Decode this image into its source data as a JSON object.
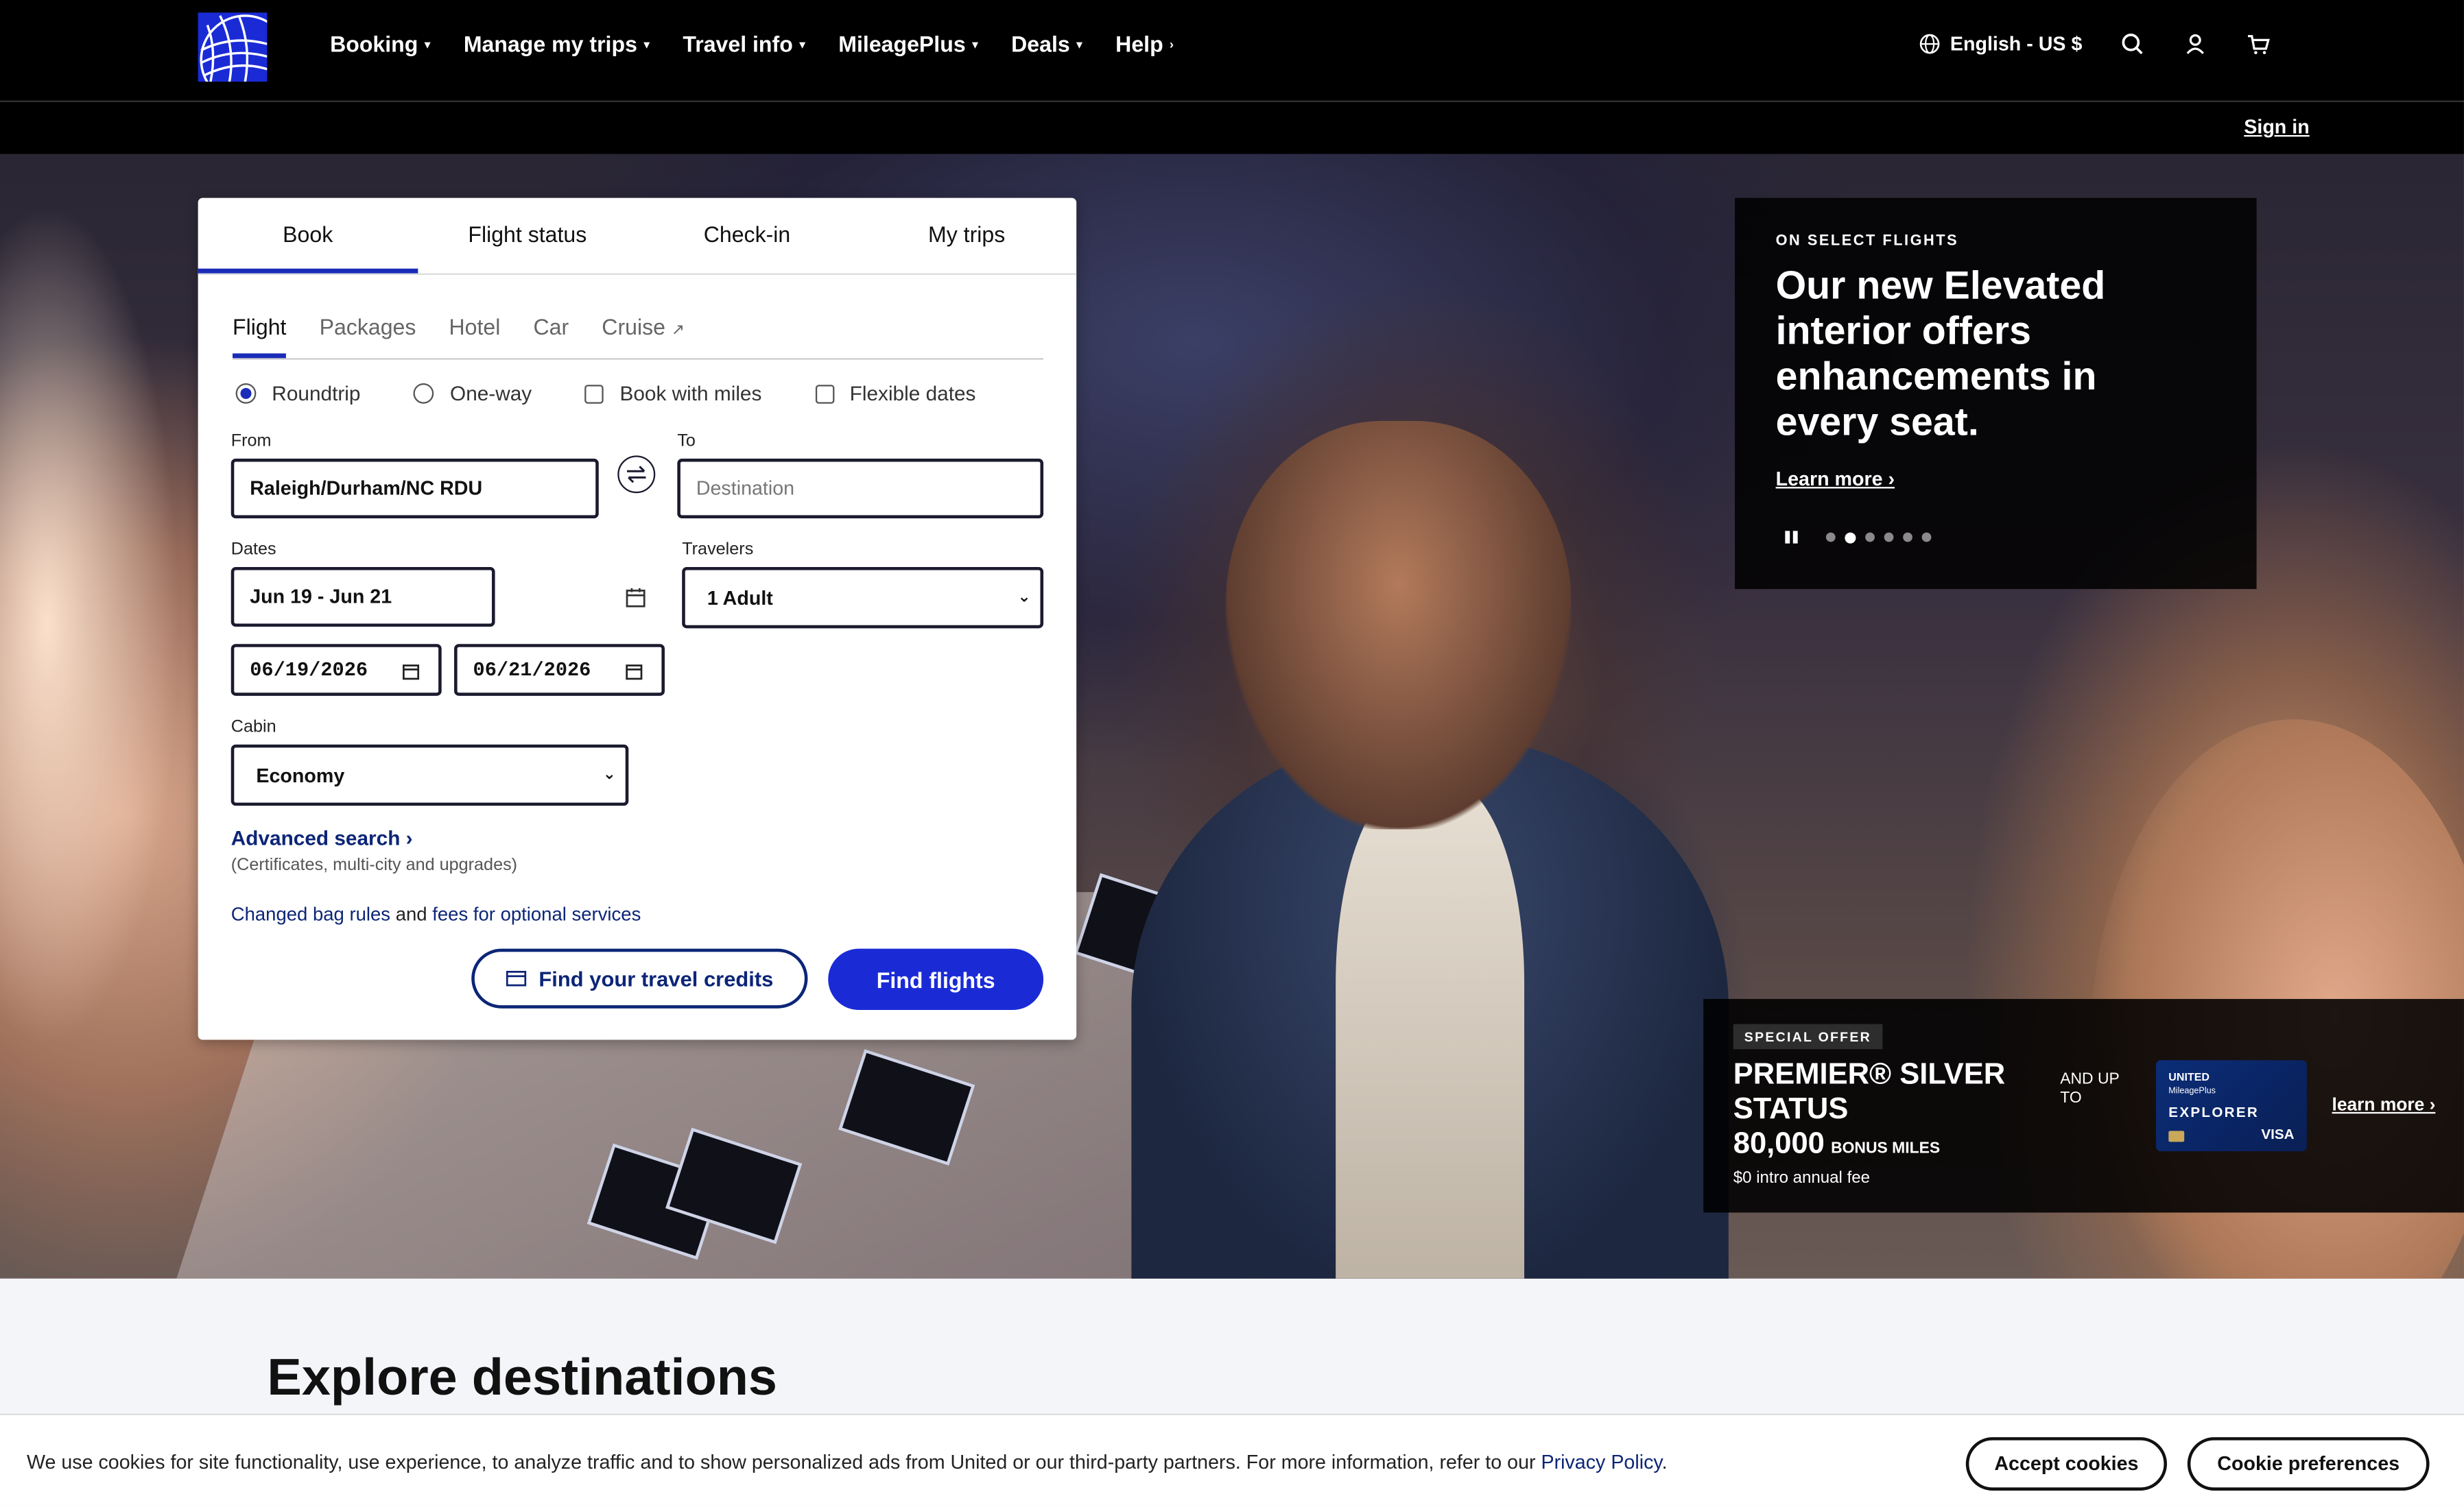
{
  "header": {
    "nav": [
      {
        "label": "Booking",
        "arrow": "▾"
      },
      {
        "label": "Manage my trips",
        "arrow": "▾"
      },
      {
        "label": "Travel info",
        "arrow": "▾"
      },
      {
        "label": "MileagePlus",
        "arrow": "▾"
      },
      {
        "label": "Deals",
        "arrow": "▾"
      },
      {
        "label": "Help",
        "arrow": "›"
      }
    ],
    "language": "English - US $",
    "icons": [
      "globe-icon",
      "search-icon",
      "user-icon",
      "cart-icon"
    ],
    "sign_in": "Sign in"
  },
  "booking": {
    "tabs": [
      "Book",
      "Flight status",
      "Check-in",
      "My trips"
    ],
    "active_tab": "Book",
    "subtabs": [
      "Flight",
      "Packages",
      "Hotel",
      "Car",
      "Cruise"
    ],
    "cruise_ext_icon": "↗",
    "active_subtab": "Flight",
    "trip_options": {
      "roundtrip": "Roundtrip",
      "oneway": "One-way",
      "miles": "Book with miles",
      "flexible": "Flexible dates"
    },
    "trip_selected": "Roundtrip",
    "from_label": "From",
    "from_value": "Raleigh/Durham/NC RDU",
    "to_label": "To",
    "to_placeholder": "Destination",
    "dates_label": "Dates",
    "dates_value": "Jun 19 - Jun 21",
    "depart_date": "06/19/2026",
    "return_date": "06/21/2026",
    "travelers_label": "Travelers",
    "travelers_value": "1 Adult",
    "cabin_label": "Cabin",
    "cabin_value": "Economy",
    "advanced": "Advanced search ›",
    "advanced_sub": "(Certificates, multi-city and upgrades)",
    "bag_link": "Changed bag rules",
    "bag_and": " and ",
    "fees_link": "fees for optional services",
    "credits_button": "Find your travel credits",
    "find_button": "Find flights"
  },
  "promo": {
    "kicker": "ON SELECT FLIGHTS",
    "title": "Our new Elevated interior offers enhancements in every seat.",
    "link": "Learn more ›",
    "slide_count": 6,
    "active_slide": 2
  },
  "offer": {
    "badge": "SPECIAL OFFER",
    "title": "PREMIER® SILVER STATUS",
    "miles": "80,000",
    "bonus": "BONUS MILES",
    "fee": "$0 intro annual fee",
    "andup": "AND UP TO",
    "card_brand": "UNITED",
    "card_program": "MileagePlus",
    "card_name": "EXPLORER",
    "card_network": "VISA",
    "link": "learn more ›"
  },
  "explore": {
    "title": "Explore destinations"
  },
  "cookie": {
    "text": "We use cookies for site functionality, use experience, to analyze traffic and to show personalized ads from United or our third-party partners. For more information, refer to our ",
    "policy": "Privacy Policy",
    "period": ".",
    "accept": "Accept cookies",
    "prefs": "Cookie preferences"
  },
  "colors": {
    "brand_blue": "#1a2bd6",
    "link_blue": "#0c2577"
  }
}
